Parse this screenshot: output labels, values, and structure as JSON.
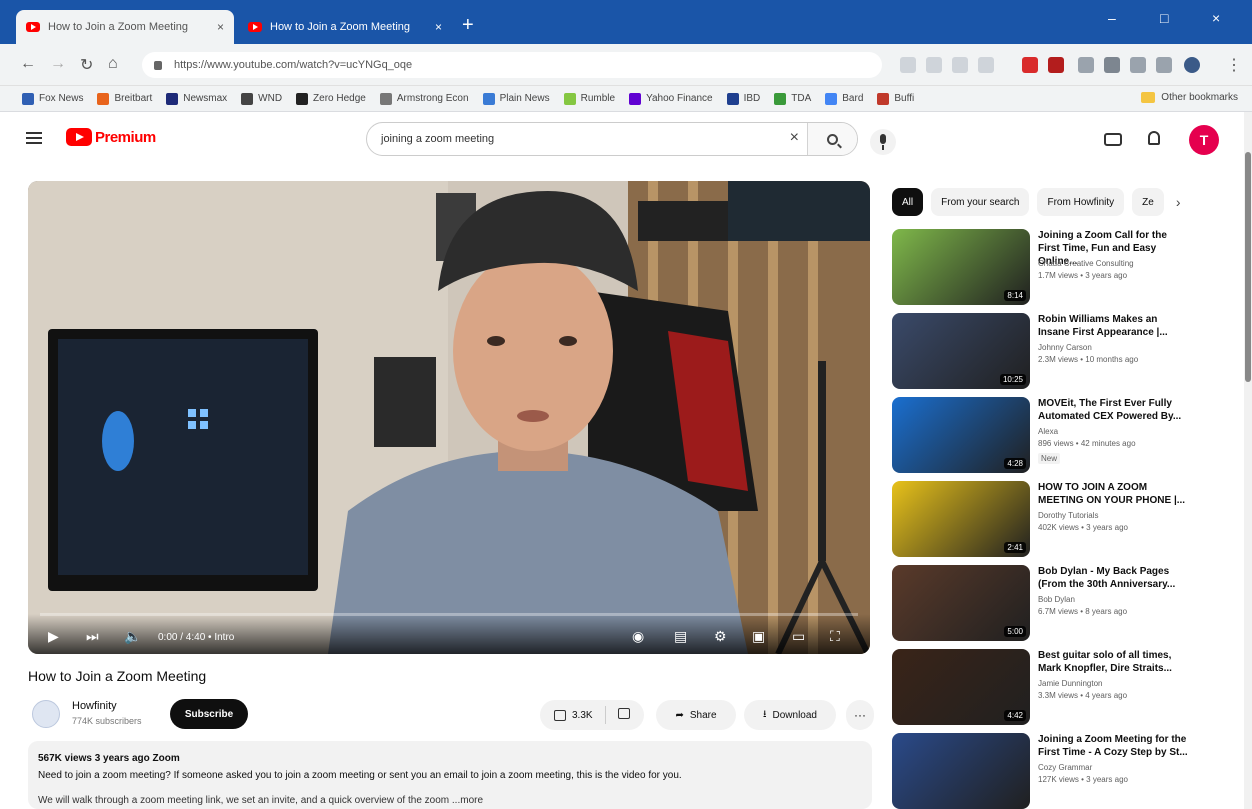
{
  "browser": {
    "tabs": [
      {
        "title": "How to Join a Zoom Meeting",
        "close": "×"
      },
      {
        "title": "How to Join a Zoom Meeting",
        "close": "×"
      }
    ],
    "new_tab": "+",
    "window_controls": {
      "minimize": "–",
      "maximize": "□",
      "close": "×"
    },
    "url": "https://www.youtube.com/watch?v=ucYNGq_oqe",
    "bookmarks": [
      {
        "label": "Fox News",
        "color": "#2f5fb3"
      },
      {
        "label": "Breitbart",
        "color": "#e8641c"
      },
      {
        "label": "Newsmax",
        "color": "#1e2a78"
      },
      {
        "label": "WND",
        "color": "#444444"
      },
      {
        "label": "Zero Hedge",
        "color": "#222222"
      },
      {
        "label": "Armstrong Econ",
        "color": "#777777"
      },
      {
        "label": "Plain News",
        "color": "#3a7bd5"
      },
      {
        "label": "Rumble",
        "color": "#85c742"
      },
      {
        "label": "Yahoo Finance",
        "color": "#6001d2"
      },
      {
        "label": "IBD",
        "color": "#1f3f8f"
      },
      {
        "label": "TDA",
        "color": "#3a9a3a"
      },
      {
        "label": "Bard",
        "color": "#4285f4"
      },
      {
        "label": "Buffi",
        "color": "#c0392b"
      }
    ],
    "other_bookmarks": "Other bookmarks"
  },
  "youtube": {
    "logo_text": "Premium",
    "search_value": "joining a zoom meeting",
    "clear_label": "×",
    "avatar_letter": "T"
  },
  "player": {
    "time": "0:00 / 4:40",
    "chapter": "• Intro",
    "progress": 0.0
  },
  "video": {
    "title": "How to Join a Zoom Meeting",
    "channel": "Howfinity",
    "subscribers": "774K subscribers",
    "subscribe": "Subscribe",
    "likes": "3.3K",
    "share": "Share",
    "download": "Download",
    "more": "···",
    "description_meta": "567K views  3 years ago  Zoom",
    "description_line1": "Need to join a zoom meeting? If someone asked you to join a zoom meeting or sent you an email to join a zoom meeting, this is the video for you.",
    "description_line2": "We will walk through a zoom meeting link, we set an invite, and a quick overview of the zoom ...more"
  },
  "sidebar": {
    "chips": [
      "All",
      "From your search",
      "From Howfinity",
      "Ze"
    ],
    "next_chip": "›",
    "recommendations": [
      {
        "title": "Joining a Zoom Call for the First Time, Fun and Easy Online...",
        "channel": "Chada Creative Consulting",
        "meta": "1.7M views • 3 years ago",
        "duration": "8:14",
        "badge": ""
      },
      {
        "title": "Robin Williams Makes an Insane First Appearance |...",
        "channel": "Johnny Carson",
        "meta": "2.3M views • 10 months ago",
        "duration": "10:25",
        "badge": ""
      },
      {
        "title": "MOVEit, The First Ever Fully Automated CEX Powered By...",
        "channel": "Alexa",
        "meta": "896 views • 42 minutes ago",
        "duration": "4:28",
        "badge": "New"
      },
      {
        "title": "HOW TO JOIN A ZOOM MEETING ON YOUR PHONE |...",
        "channel": "Dorothy Tutorials",
        "meta": "402K views • 3 years ago",
        "duration": "2:41",
        "badge": ""
      },
      {
        "title": "Bob Dylan - My Back Pages (From the 30th Anniversary...",
        "channel": "Bob Dylan",
        "meta": "6.7M views • 8 years ago",
        "duration": "5:00",
        "badge": ""
      },
      {
        "title": "Best guitar solo of all times, Mark Knopfler, Dire Straits...",
        "channel": "Jamie Dunnington",
        "meta": "3.3M views • 4 years ago",
        "duration": "4:42",
        "badge": ""
      },
      {
        "title": "Joining a Zoom Meeting for the First Time - A Cozy Step by St...",
        "channel": "Cozy Grammar",
        "meta": "127K views • 3 years ago",
        "duration": "",
        "badge": ""
      }
    ]
  }
}
